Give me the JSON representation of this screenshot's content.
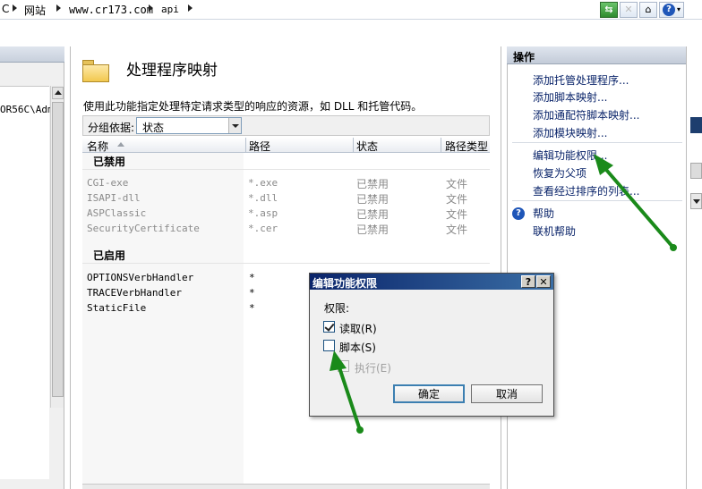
{
  "breadcrumb": {
    "items": [
      "C",
      "网站",
      "www.cr173.com",
      "api"
    ]
  },
  "left_pane": {
    "tree_text": "OR56C\\Adm"
  },
  "feature": {
    "title": "处理程序映射",
    "description": "使用此功能指定处理特定请求类型的响应的资源，如 DLL 和托管代码。",
    "group_by_label": "分组依据:",
    "group_by_value": "状态",
    "columns": [
      "名称",
      "路径",
      "状态",
      "路径类型"
    ],
    "groups": [
      {
        "name": "已禁用",
        "rows": [
          {
            "name": "CGI-exe",
            "path": "*.exe",
            "state": "已禁用",
            "path_type": "文件"
          },
          {
            "name": "ISAPI-dll",
            "path": "*.dll",
            "state": "已禁用",
            "path_type": "文件"
          },
          {
            "name": "ASPClassic",
            "path": "*.asp",
            "state": "已禁用",
            "path_type": "文件"
          },
          {
            "name": "SecurityCertificate",
            "path": "*.cer",
            "state": "已禁用",
            "path_type": "文件"
          }
        ]
      },
      {
        "name": "已启用",
        "rows": [
          {
            "name": "OPTIONSVerbHandler",
            "path": "*",
            "state": "",
            "path_type": ""
          },
          {
            "name": "TRACEVerbHandler",
            "path": "*",
            "state": "",
            "path_type": ""
          },
          {
            "name": "StaticFile",
            "path": "*",
            "state": "",
            "path_type": ""
          }
        ]
      }
    ]
  },
  "actions": {
    "title": "操作",
    "items": [
      "添加托管处理程序...",
      "添加脚本映射...",
      "添加通配符脚本映射...",
      "添加模块映射...",
      "编辑功能权限...",
      "恢复为父项",
      "查看经过排序的列表...",
      "帮助",
      "联机帮助"
    ]
  },
  "dialog": {
    "title": "编辑功能权限",
    "help_button": "?",
    "close_button": "✕",
    "permissions_label": "权限:",
    "read": {
      "label": "读取(R)",
      "checked": true
    },
    "script": {
      "label": "脚本(S)",
      "checked": false
    },
    "execute": {
      "label": "执行(E)",
      "checked": false,
      "disabled": true
    },
    "ok": "确定",
    "cancel": "取消"
  },
  "colors": {
    "annotation_arrow": "#1a8a1a",
    "dialog_titlebar": "#0a246a",
    "link_text": "#0a246a"
  }
}
